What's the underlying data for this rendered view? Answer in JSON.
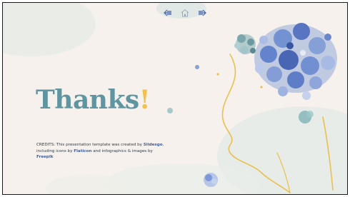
{
  "slide": {
    "title_main": "Thanks",
    "title_mark": "!"
  },
  "nav": {
    "prev_icon": "arrow-left-icon",
    "home_icon": "home-icon",
    "next_icon": "arrow-right-icon"
  },
  "credits": {
    "line_start": "CREDITS: This presentation template was created by ",
    "slidesgo": "Slidesgo",
    "middle": ", including icons by ",
    "flaticon": "Flaticon",
    "after_flaticon": " and infographics & images by ",
    "freepik": "Freepik"
  },
  "colors": {
    "title": "#5e95a1",
    "accent": "#f2c24f",
    "link": "#3c5fa8",
    "flower": "#5d7fc9",
    "line_art": "#e9c04d"
  }
}
